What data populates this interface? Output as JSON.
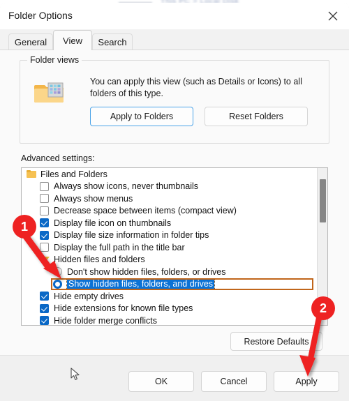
{
  "background_app": {
    "ghost_text": "This PC  >  Local Disk"
  },
  "window": {
    "title": "Folder Options",
    "close_icon": "close-icon"
  },
  "tabs": [
    {
      "label": "General",
      "active": false
    },
    {
      "label": "View",
      "active": true
    },
    {
      "label": "Search",
      "active": false
    }
  ],
  "folder_views": {
    "legend": "Folder views",
    "icon": "folder-view-icon",
    "description": "You can apply this view (such as Details or Icons) to all folders of this type.",
    "apply_to_folders_label": "Apply to Folders",
    "reset_folders_label": "Reset Folders"
  },
  "advanced": {
    "label": "Advanced settings:",
    "items": [
      {
        "type": "group",
        "indent": 0,
        "icon": "folder-icon",
        "label": "Files and Folders",
        "state": ""
      },
      {
        "type": "checkbox",
        "indent": 1,
        "icon": "checkbox-icon",
        "label": "Always show icons, never thumbnails",
        "state": "off"
      },
      {
        "type": "checkbox",
        "indent": 1,
        "icon": "checkbox-icon",
        "label": "Always show menus",
        "state": "off"
      },
      {
        "type": "checkbox",
        "indent": 1,
        "icon": "checkbox-icon",
        "label": "Decrease space between items (compact view)",
        "state": "off"
      },
      {
        "type": "checkbox",
        "indent": 1,
        "icon": "checkbox-icon",
        "label": "Display file icon on thumbnails",
        "state": "on"
      },
      {
        "type": "checkbox",
        "indent": 1,
        "icon": "checkbox-icon",
        "label": "Display file size information in folder tips",
        "state": "on"
      },
      {
        "type": "checkbox",
        "indent": 1,
        "icon": "checkbox-icon",
        "label": "Display the full path in the title bar",
        "state": "off"
      },
      {
        "type": "group",
        "indent": 1,
        "icon": "triangle-open-icon",
        "label": "Hidden files and folders",
        "state": ""
      },
      {
        "type": "radio",
        "indent": 2,
        "icon": "radio-icon",
        "label": "Don't show hidden files, folders, or drives",
        "state": "off"
      },
      {
        "type": "radio",
        "indent": 2,
        "icon": "radio-icon",
        "label": "Show hidden files, folders, and drives",
        "state": "on",
        "selected": true
      },
      {
        "type": "checkbox",
        "indent": 1,
        "icon": "checkbox-icon",
        "label": "Hide empty drives",
        "state": "on"
      },
      {
        "type": "checkbox",
        "indent": 1,
        "icon": "checkbox-icon",
        "label": "Hide extensions for known file types",
        "state": "on"
      },
      {
        "type": "checkbox",
        "indent": 1,
        "icon": "checkbox-icon",
        "label": "Hide folder merge conflicts",
        "state": "on"
      }
    ],
    "scrollbar": {
      "name": "vertical-scrollbar"
    }
  },
  "restore_defaults_label": "Restore Defaults",
  "footer": {
    "ok_label": "OK",
    "cancel_label": "Cancel",
    "apply_label": "Apply"
  },
  "annotations": [
    {
      "number": "1",
      "points_to": "show-hidden-files-radio"
    },
    {
      "number": "2",
      "points_to": "apply-button"
    }
  ],
  "colors": {
    "accent": "#0b72d6",
    "annotation": "#ee2222",
    "focus_outline": "#c0651a",
    "folder_yellow": "#f6c152"
  },
  "cursor": {
    "name": "mouse-cursor"
  }
}
